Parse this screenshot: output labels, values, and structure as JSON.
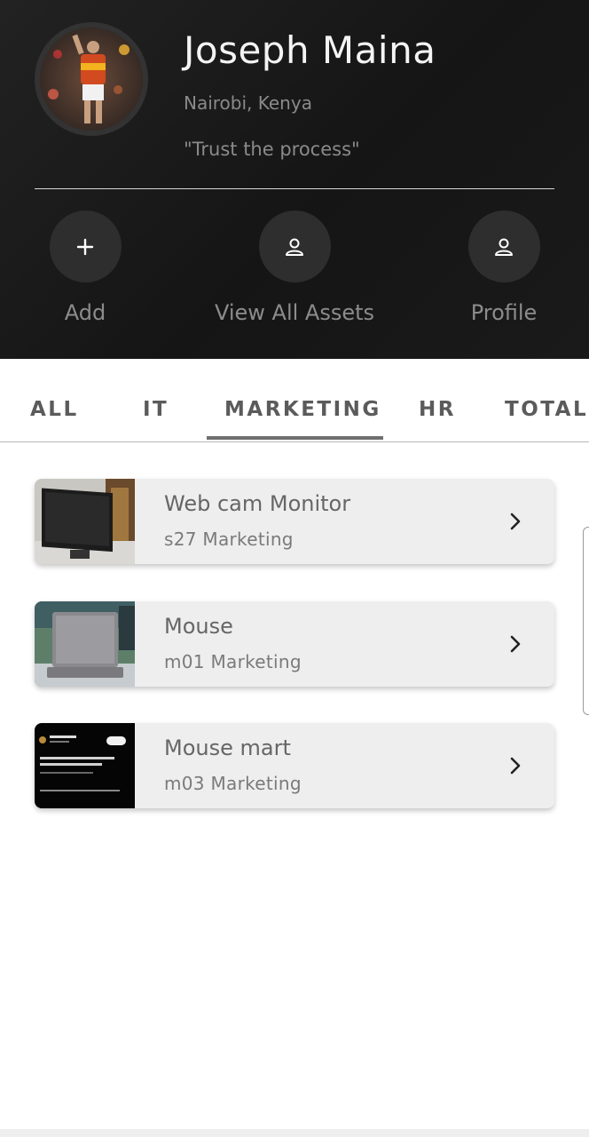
{
  "profile": {
    "name": "Joseph Maina",
    "location": "Nairobi, Kenya",
    "quote": "\"Trust the process\""
  },
  "actions": [
    {
      "label": "Add",
      "icon": "plus-icon"
    },
    {
      "label": "View All Assets",
      "icon": "person-icon"
    },
    {
      "label": "Profile",
      "icon": "person-icon"
    }
  ],
  "tabs": [
    {
      "label": "ALL"
    },
    {
      "label": "IT"
    },
    {
      "label": "MARKETING"
    },
    {
      "label": "HR"
    },
    {
      "label": "TOTAL"
    }
  ],
  "selected_tab": "MARKETING",
  "assets": [
    {
      "name": "Web cam Monitor",
      "subtitle": "s27 Marketing",
      "thumbnail": "monitor-photo"
    },
    {
      "name": "Mouse",
      "subtitle": "m01 Marketing",
      "thumbnail": "laptop-photo"
    },
    {
      "name": "Mouse mart",
      "subtitle": "m03 Marketing",
      "thumbnail": "tweet-screenshot"
    }
  ],
  "colors": {
    "header_bg": "#1a1a1a",
    "card_bg": "#eeeeee",
    "tab_indicator": "#6f6f6f"
  }
}
